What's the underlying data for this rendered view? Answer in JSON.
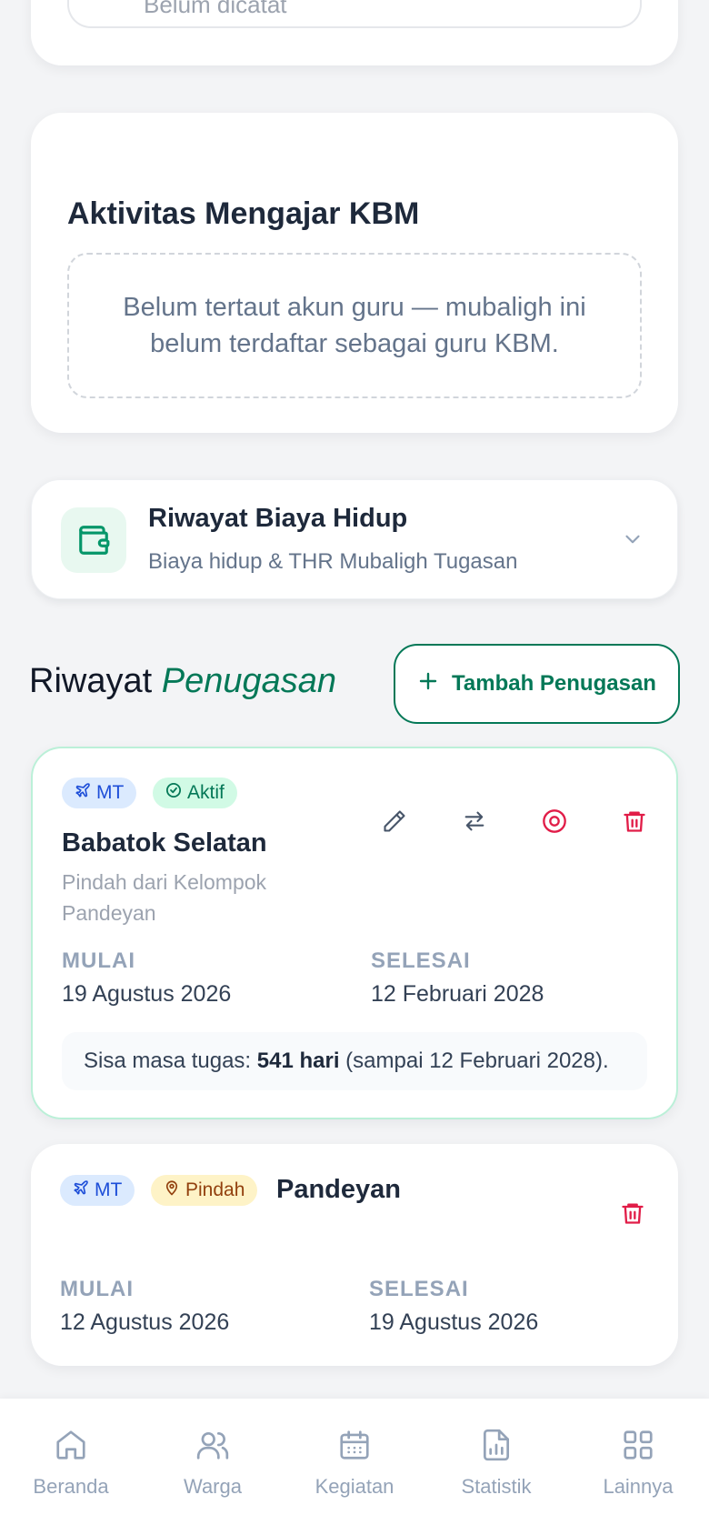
{
  "top_card": {
    "field_text": "Belum dicatat"
  },
  "kbm": {
    "title": "Aktivitas Mengajar KBM",
    "empty_message": "Belum tertaut akun guru — mubaligh ini belum terdaftar sebagai guru KBM."
  },
  "biaya": {
    "icon": "wallet-icon",
    "title": "Riwayat Biaya Hidup",
    "subtitle": "Biaya hidup & THR Mubaligh Tugasan"
  },
  "section": {
    "title_plain": "Riwayat",
    "title_accent": "Penugasan",
    "add_button_label": "Tambah Penugasan"
  },
  "assignments": [
    {
      "type_badge": "MT",
      "status_badge": "Aktif",
      "place": "Babatok Selatan",
      "origin": "Pindah dari Kelompok Pandeyan",
      "start_label": "MULAI",
      "start_date": "19 Agustus 2026",
      "end_label": "SELESAI",
      "end_date": "12 Februari 2028",
      "remaining_prefix": "Sisa masa tugas: ",
      "remaining_days": "541 hari",
      "remaining_suffix": " (sampai 12 Februari 2028)."
    },
    {
      "type_badge": "MT",
      "status_badge": "Pindah",
      "place": "Pandeyan",
      "start_label": "MULAI",
      "start_date": "12 Agustus 2026",
      "end_label": "SELESAI",
      "end_date": "19 Agustus 2026"
    }
  ],
  "colors": {
    "accent": "#047857",
    "danger": "#e11d48",
    "muted": "#94a3b8"
  },
  "nav": [
    {
      "label": "Beranda",
      "icon": "home-icon"
    },
    {
      "label": "Warga",
      "icon": "users-icon"
    },
    {
      "label": "Kegiatan",
      "icon": "calendar-icon"
    },
    {
      "label": "Statistik",
      "icon": "chart-file-icon"
    },
    {
      "label": "Lainnya",
      "icon": "grid-icon"
    }
  ]
}
